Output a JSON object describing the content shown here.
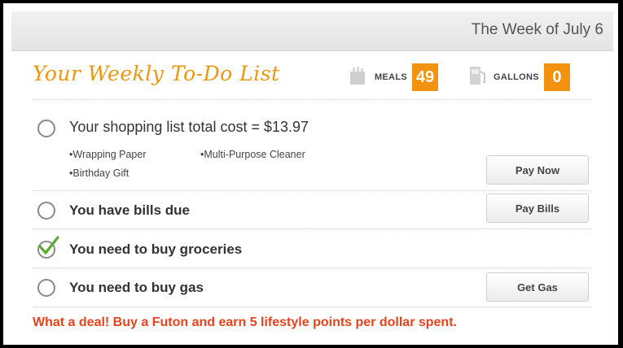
{
  "header": {
    "week": "The Week of July 6"
  },
  "title": "Your Weekly To-Do List",
  "stats": {
    "meals": {
      "label": "MEALS",
      "value": "49",
      "icon": "meals-icon"
    },
    "gallons": {
      "label": "GALLONS",
      "value": "0",
      "icon": "gas-pump-icon"
    }
  },
  "accent_color": "#f2920f",
  "tasks": [
    {
      "text": "Your shopping list total cost = $13.97",
      "checked": false,
      "items": [
        "Wrapping Paper",
        "Multi-Purpose Cleaner",
        "Birthday Gift"
      ],
      "button": "Pay Now"
    },
    {
      "text": "You have bills due",
      "checked": false,
      "button": "Pay Bills"
    },
    {
      "text": "You need to buy groceries",
      "checked": true
    },
    {
      "text": "You need to buy gas",
      "checked": false,
      "button": "Get Gas"
    }
  ],
  "promo": "What a deal! Buy a Futon and earn 5 lifestyle points per dollar spent."
}
